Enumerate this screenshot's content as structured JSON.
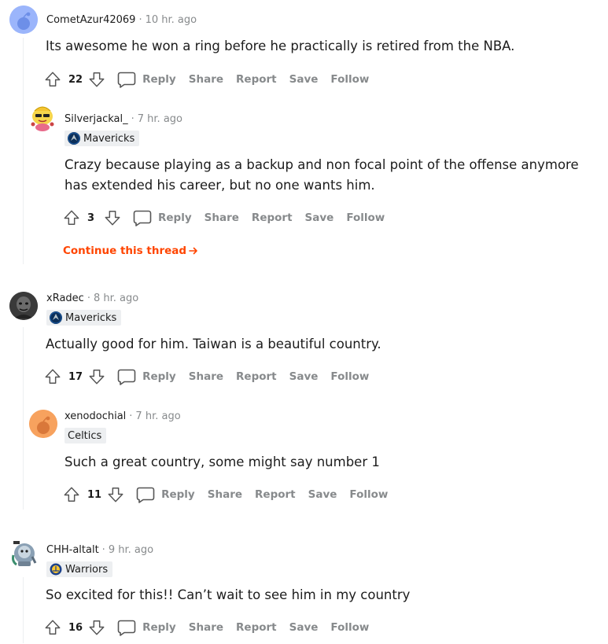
{
  "comments": [
    {
      "username": "CometAzur42069",
      "separator": "·",
      "time": "10 hr. ago",
      "avatar_icon": "default-snoo-avatar-icon",
      "flair": null,
      "body": "Its awesome he won a ring before he practically is retired from the NBA.",
      "score": "22"
    },
    {
      "username": "Silverjackal_",
      "separator": "·",
      "time": "7 hr. ago",
      "avatar_icon": "cartoon-snoo-avatar-icon",
      "flair": "Mavericks",
      "flair_icon": "mavericks-logo-icon",
      "body_lines": [
        "Crazy because playing as a backup and non focal point of the offense anymore",
        "has extended his career, but no one wants him."
      ],
      "score": "3"
    },
    {
      "username": "xRadec",
      "separator": "·",
      "time": "8 hr. ago",
      "avatar_icon": "dark-portrait-avatar-icon",
      "flair": "Mavericks",
      "flair_icon": "mavericks-logo-icon",
      "body": "Actually good for him. Taiwan is a beautiful country.",
      "score": "17"
    },
    {
      "username": "xenodochial",
      "separator": "·",
      "time": "7 hr. ago",
      "avatar_icon": "default-snoo-avatar-icon",
      "flair": "Celtics",
      "body": "Such a great country, some might say number 1",
      "score": "11"
    },
    {
      "username": "CHH-altalt",
      "separator": "·",
      "time": "9 hr. ago",
      "avatar_icon": "robot-snoo-avatar-icon",
      "flair": "Warriors",
      "flair_icon": "warriors-logo-icon",
      "body": "So excited for this!! Can’t wait to see him in my country",
      "score": "16"
    }
  ],
  "actions": {
    "reply": "Reply",
    "share": "Share",
    "report": "Report",
    "save": "Save",
    "follow": "Follow"
  },
  "continue_thread": "Continue this thread",
  "colors": {
    "accent": "#ff4500",
    "muted": "#878a8c",
    "flair_bg": "#edeff1",
    "avatar_blue": "#9bb5fb",
    "avatar_orange": "#f7a25e"
  }
}
